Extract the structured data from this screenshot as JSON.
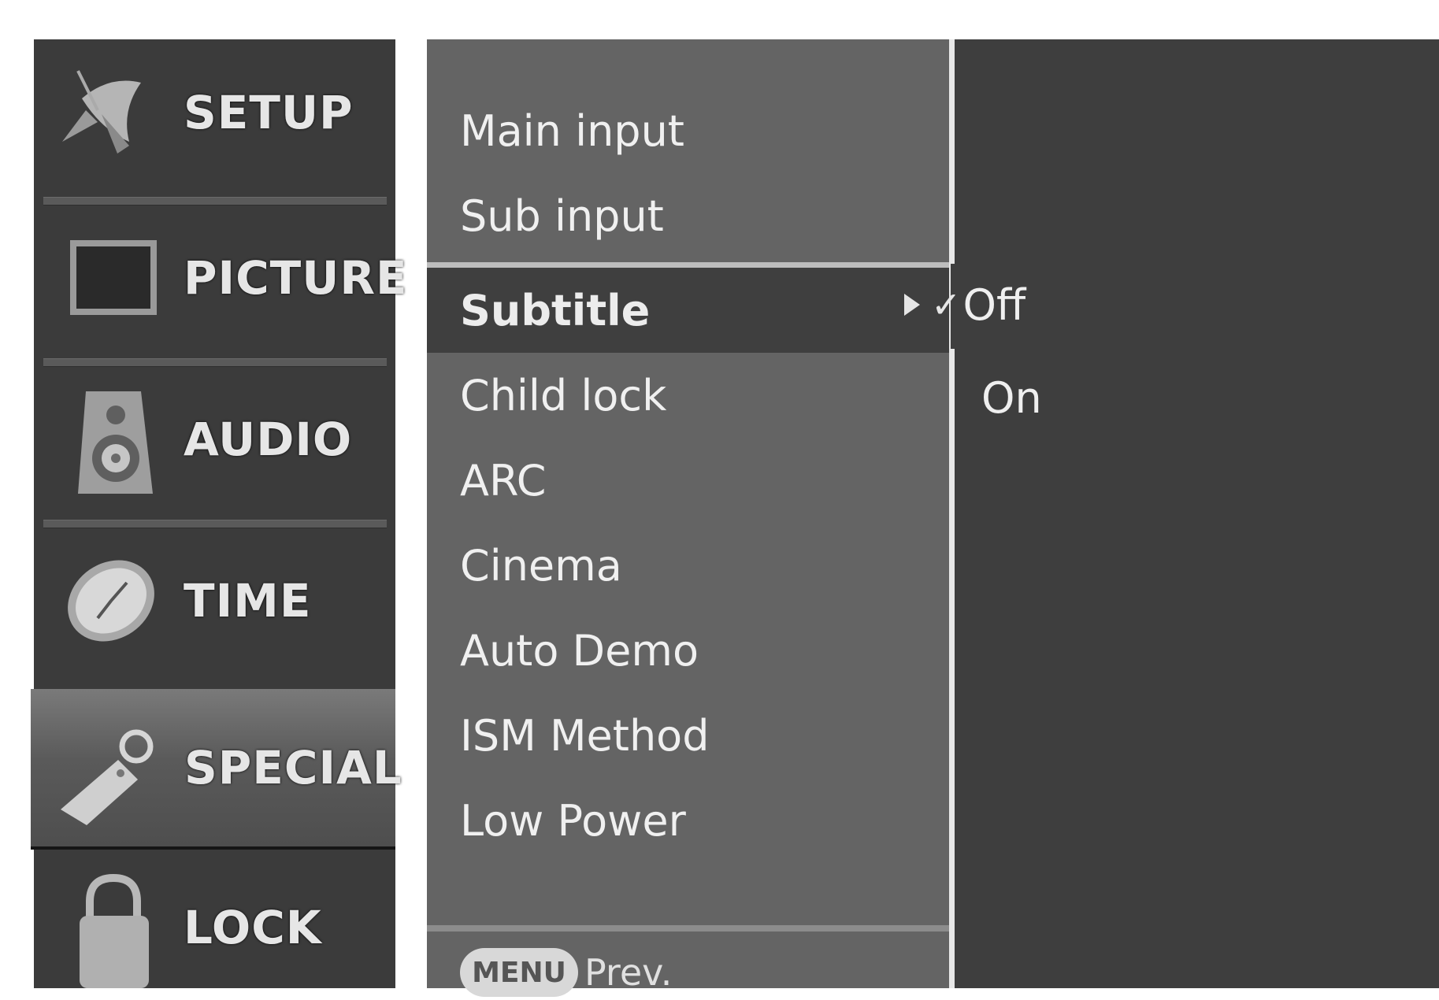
{
  "sidebar": {
    "items": [
      {
        "label": "SETUP",
        "icon": "satellite-icon"
      },
      {
        "label": "PICTURE",
        "icon": "monitor-icon"
      },
      {
        "label": "AUDIO",
        "icon": "speaker-icon"
      },
      {
        "label": "TIME",
        "icon": "clock-icon"
      },
      {
        "label": "SPECIAL",
        "icon": "key-tag-icon",
        "selected": true
      },
      {
        "label": "LOCK",
        "icon": "padlock-icon"
      }
    ]
  },
  "menu": {
    "items": [
      {
        "label": "Main input"
      },
      {
        "label": "Sub input"
      },
      {
        "label": "Subtitle",
        "selected": true
      },
      {
        "label": "Child lock"
      },
      {
        "label": "ARC"
      },
      {
        "label": "Cinema"
      },
      {
        "label": "Auto Demo"
      },
      {
        "label": "ISM Method"
      },
      {
        "label": "Low Power"
      }
    ],
    "footer": {
      "key_label": "MENU",
      "text": "Prev."
    }
  },
  "submenu": {
    "options": [
      {
        "label": "Off",
        "checked": true
      },
      {
        "label": "On",
        "checked": false
      }
    ]
  }
}
